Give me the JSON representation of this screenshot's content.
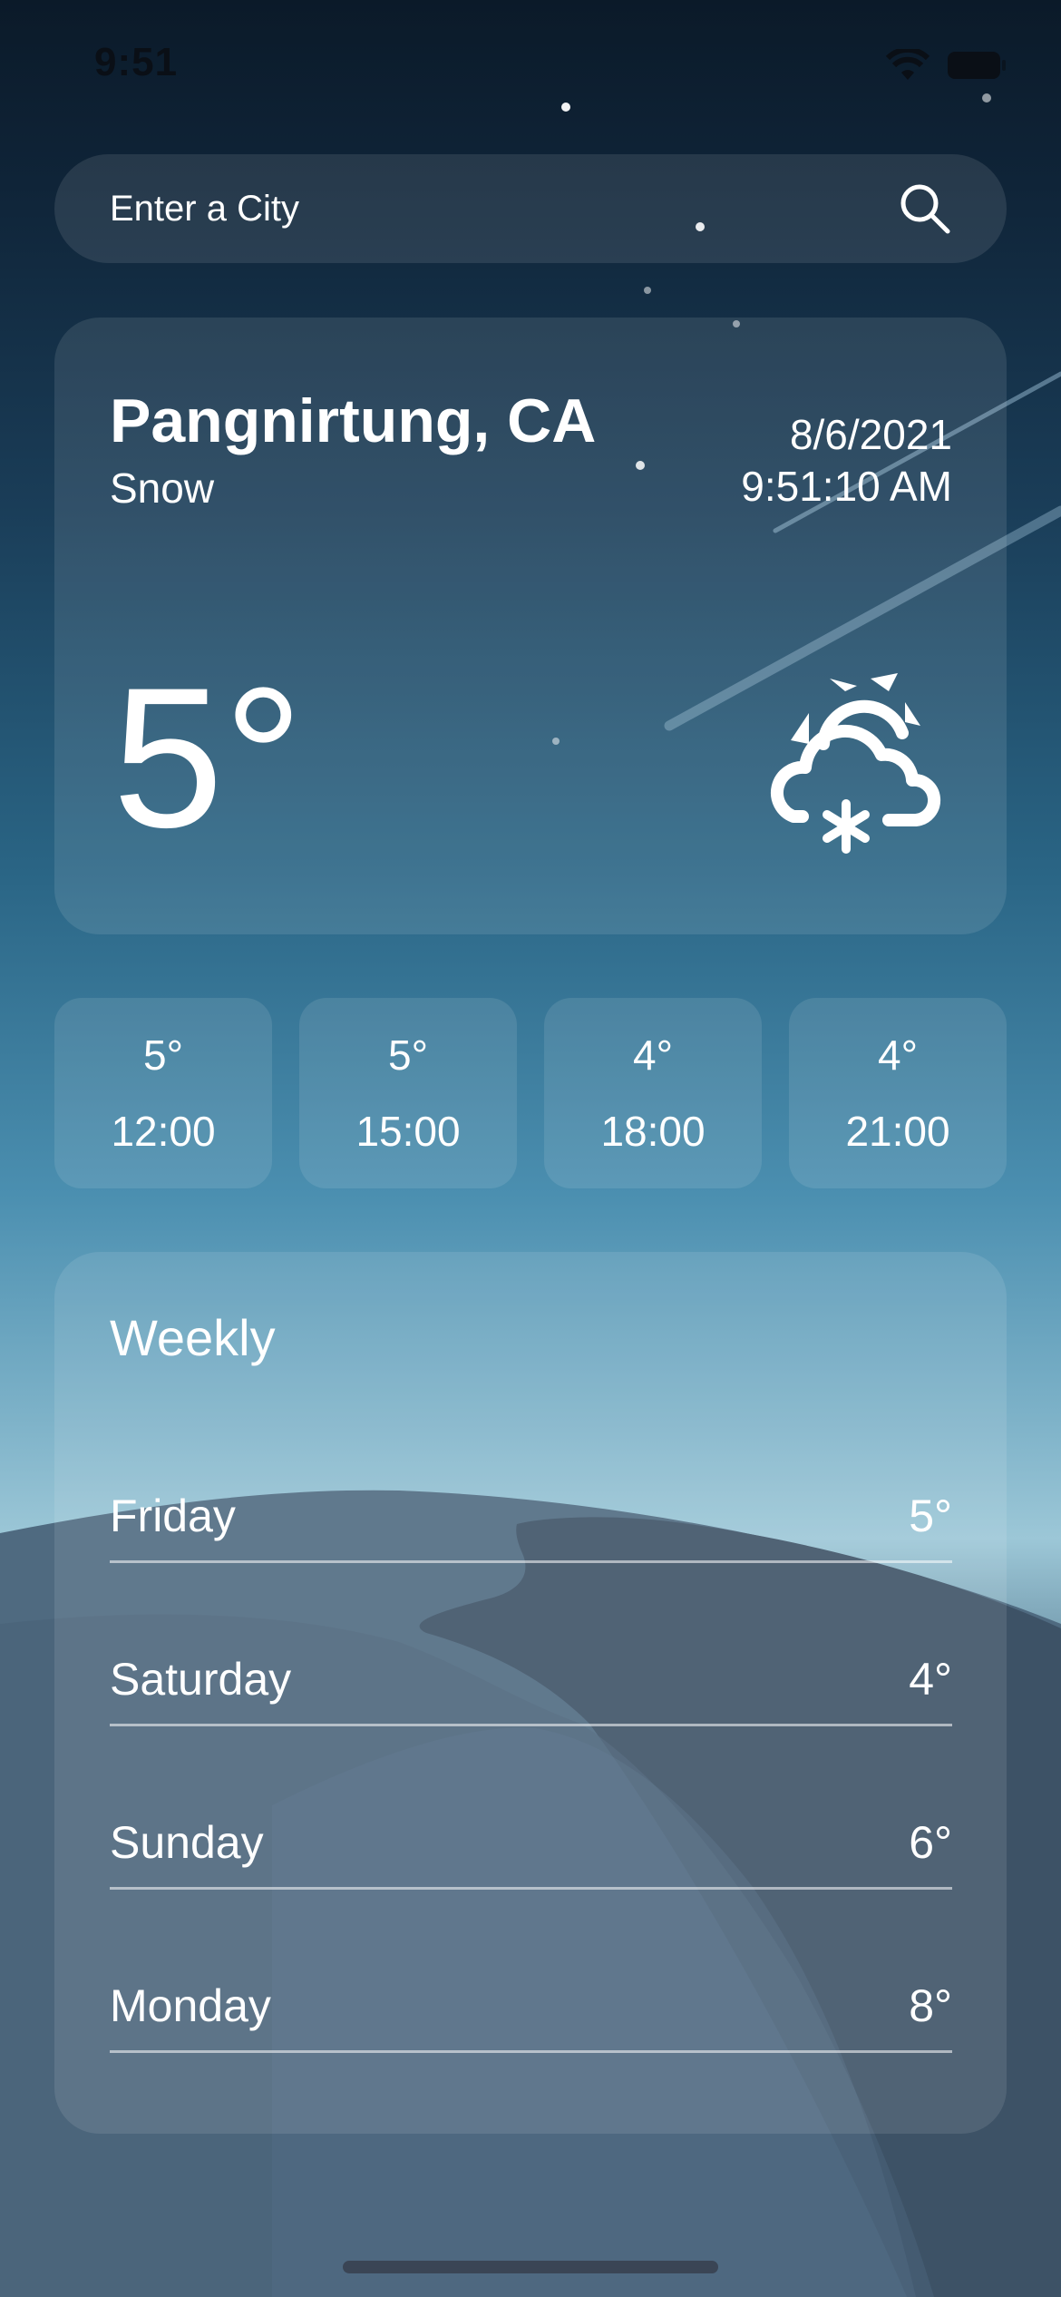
{
  "status_bar": {
    "time": "9:51"
  },
  "search": {
    "placeholder": "Enter a City"
  },
  "current": {
    "city": "Pangnirtung, CA",
    "condition": "Snow",
    "date": "8/6/2021",
    "time": "9:51:10 AM",
    "temperature": "5°",
    "icon": "partly-sunny-snow-icon"
  },
  "hourly": [
    {
      "temp": "5°",
      "time": "12:00"
    },
    {
      "temp": "5°",
      "time": "15:00"
    },
    {
      "temp": "4°",
      "time": "18:00"
    },
    {
      "temp": "4°",
      "time": "21:00"
    }
  ],
  "weekly": {
    "title": "Weekly",
    "days": [
      {
        "day": "Friday",
        "temp": "5°"
      },
      {
        "day": "Saturday",
        "temp": "4°"
      },
      {
        "day": "Sunday",
        "temp": "6°"
      },
      {
        "day": "Monday",
        "temp": "8°"
      }
    ]
  },
  "colors": {
    "sky_top": "#0b1a29",
    "sky_mid": "#4b8fb0",
    "sky_horizon": "#9cc7d7",
    "dune_dark": "#3c5569"
  }
}
